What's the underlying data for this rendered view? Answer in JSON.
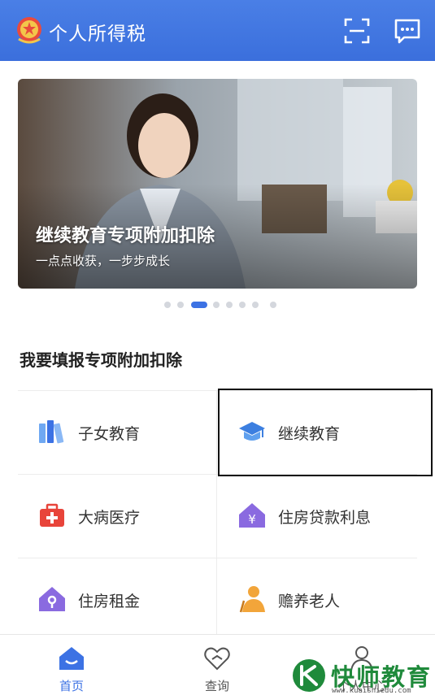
{
  "header": {
    "title": "个人所得税",
    "scan_icon": "scan-icon",
    "message_icon": "message-icon"
  },
  "banner": {
    "title": "继续教育专项附加扣除",
    "subtitle": "一点点收获，一步步成长",
    "active_dot": 3,
    "dot_count": 8
  },
  "section": {
    "title": "我要填报专项附加扣除"
  },
  "items": [
    {
      "label": "子女教育",
      "icon": "books-icon"
    },
    {
      "label": "继续教育",
      "icon": "graduation-cap-icon"
    },
    {
      "label": "大病医疗",
      "icon": "medical-kit-icon"
    },
    {
      "label": "住房贷款利息",
      "icon": "house-yen-icon"
    },
    {
      "label": "住房租金",
      "icon": "house-key-icon"
    },
    {
      "label": "赡养老人",
      "icon": "elderly-icon"
    }
  ],
  "tabbar": {
    "tabs": [
      {
        "label": "首页",
        "icon": "home-icon",
        "active": true
      },
      {
        "label": "查询",
        "icon": "heart-search-icon",
        "active": false
      },
      {
        "label": "个人中心",
        "icon": "user-icon",
        "active": false
      }
    ]
  },
  "watermark": {
    "text": "快师教育",
    "url": "www.kuaishiedu.com"
  },
  "colors": {
    "primary": "#3c72e4",
    "header": "#4a7fe6",
    "text": "#333333"
  }
}
